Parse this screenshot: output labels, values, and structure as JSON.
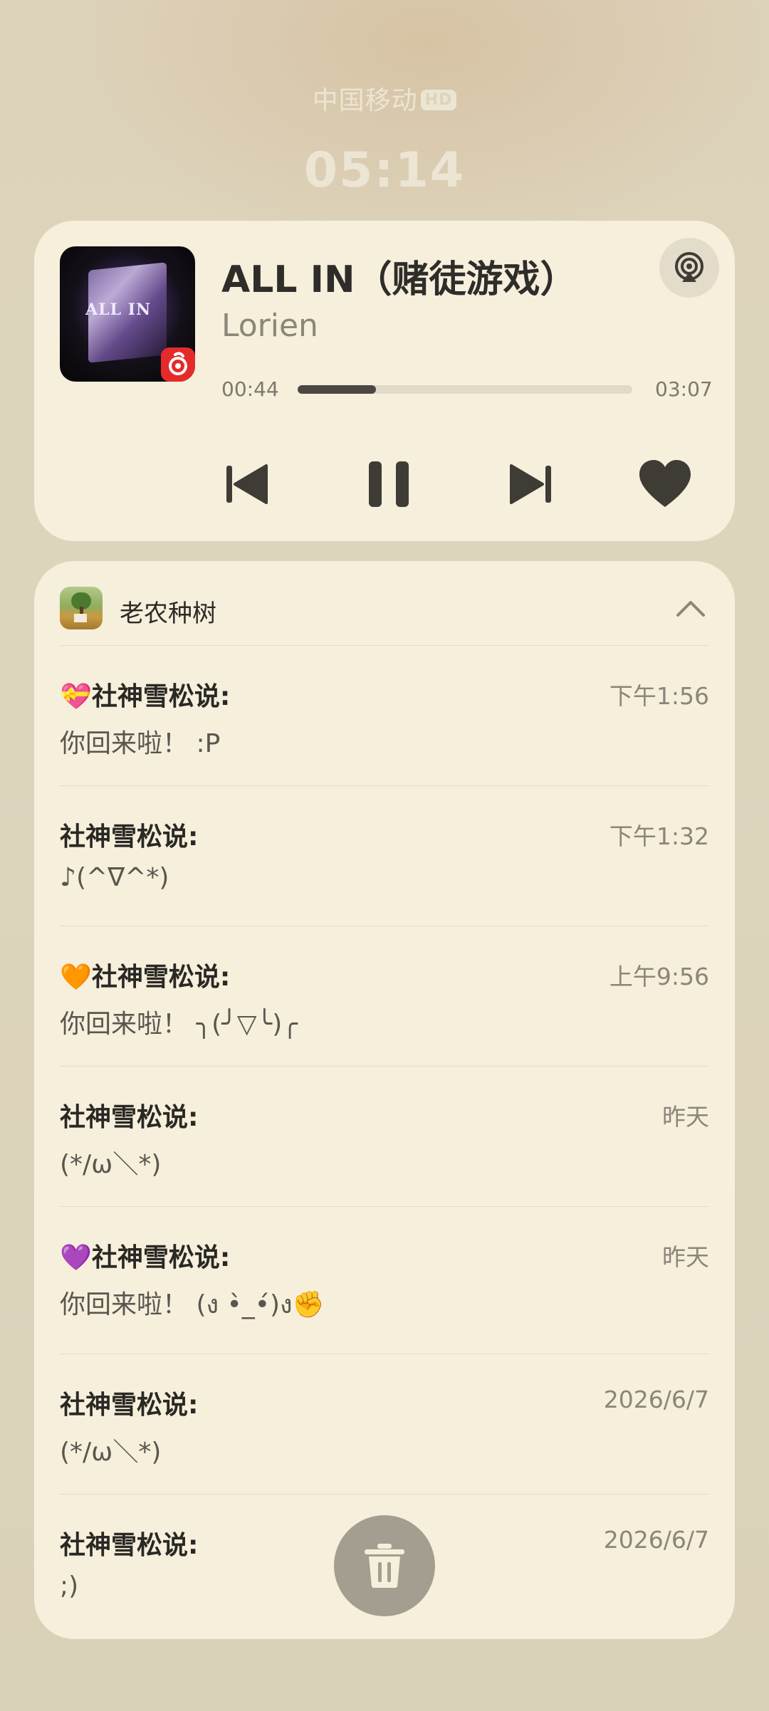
{
  "status_bar": {
    "carrier": "中国移动",
    "network_badge": "HD",
    "clock": "05:14"
  },
  "music": {
    "album_art_text": "ALL IN",
    "app_badge_icon": "netease-music-icon",
    "title": "ALL IN（赌徒游戏）",
    "artist": "Lorien",
    "elapsed": "00:44",
    "total": "03:07",
    "progress_fraction": 0.235,
    "controls": [
      "previous-icon",
      "pause-icon",
      "next-icon",
      "heart-icon"
    ]
  },
  "notification_group": {
    "app_name": "老农种树",
    "items": [
      {
        "sender": "💝社神雪松说:",
        "time": "下午1:56",
        "body": "你回来啦！ :P"
      },
      {
        "sender": "社神雪松说:",
        "time": "下午1:32",
        "body": "♪(^∇^*)"
      },
      {
        "sender": "🧡社神雪松说:",
        "time": "上午9:56",
        "body": "你回来啦！ ╮(╯▽╰)╭"
      },
      {
        "sender": "社神雪松说:",
        "time": "昨天",
        "body": "(*/ω＼*)"
      },
      {
        "sender": "💜社神雪松说:",
        "time": "昨天",
        "body": "你回来啦！ (ง •̀_•́)ง✊"
      },
      {
        "sender": "社神雪松说:",
        "time": "2026/6/7",
        "body": "(*/ω＼*)"
      },
      {
        "sender": "社神雪松说:",
        "time": "2026/6/7",
        "body": ";)"
      }
    ]
  },
  "colors": {
    "background": "#ddd4bc",
    "card": "#f6efdc",
    "accent_dark": "#4b4742",
    "delete_button": "#a39e8f"
  }
}
